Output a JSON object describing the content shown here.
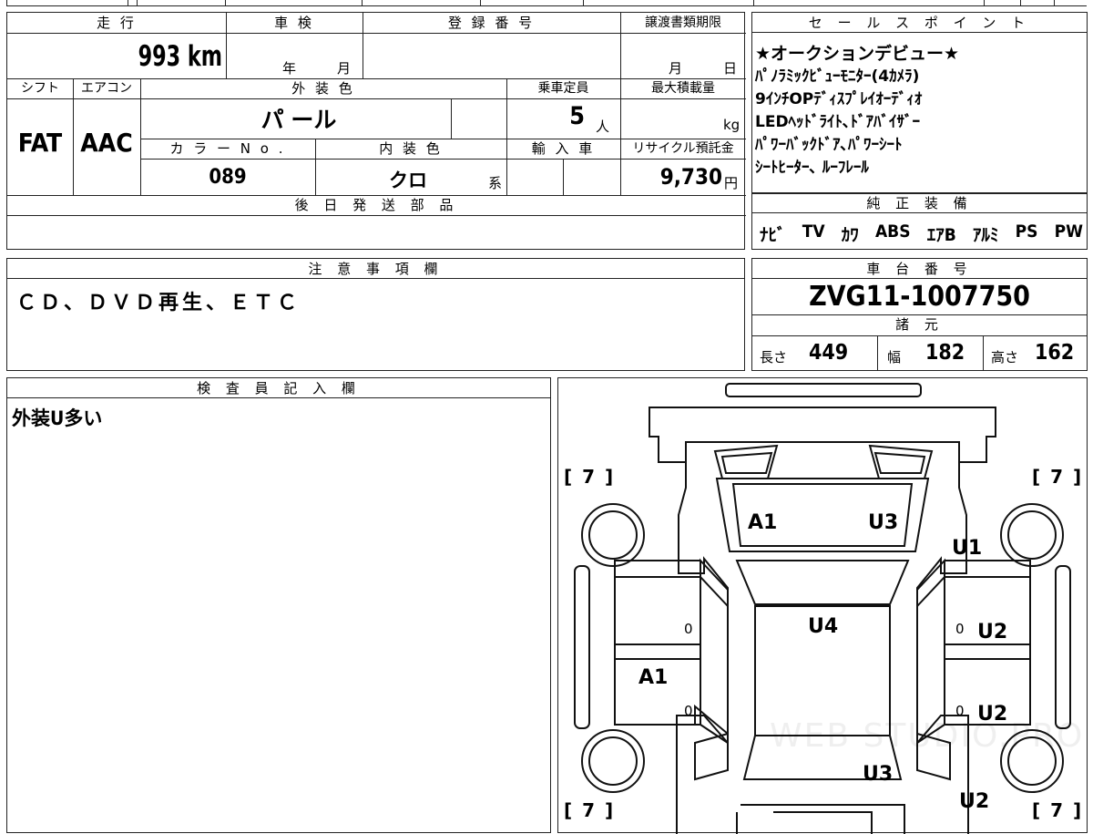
{
  "vehicle": {
    "headers": {
      "mileage": "走 行",
      "inspection": "車 検",
      "registration": "登 録 番 号",
      "transfer_deadline": "譲渡書類期限",
      "shift": "シフト",
      "aircon": "エアコン",
      "exterior_color": "外 装 色",
      "capacity": "乗車定員",
      "max_load": "最大積載量",
      "color_no": "カ ラ ー N o .",
      "interior_color": "内 装 色",
      "import": "輸 入 車",
      "recycle_fee": "リサイクル預託金",
      "later_parts": "後 日 発 送 部 品"
    },
    "mileage": "993",
    "mileage_unit": "km",
    "inspection_year_label": "年",
    "inspection_month_label": "月",
    "deadline_month_label": "月",
    "deadline_day_label": "日",
    "shift": "FAT",
    "aircon": "AAC",
    "exterior_color": "パ ール",
    "capacity": "5",
    "capacity_unit": "人",
    "max_load_unit": "kg",
    "color_no": "089",
    "interior_color": "クロ",
    "interior_suffix": "系",
    "recycle_fee": "9,730",
    "recycle_unit": "円"
  },
  "sales_points": {
    "header": "セ ー ル ス ポ イ ン ト",
    "lines": [
      "★オークションデビュー★",
      "ﾊﾟﾉﾗﾐｯｸﾋﾞｭｰﾓﾆﾀｰ(4ｶﾒﾗ)",
      "9ｲﾝﾁOPﾃﾞｨｽﾌﾟﾚｲｵｰﾃﾞｨｵ",
      "LEDﾍｯﾄﾞﾗｲﾄ､ﾄﾞｱﾊﾞｲｻﾞｰ",
      "ﾊﾟﾜｰﾊﾞｯｸﾄﾞｱ､ﾊﾟﾜｰｼｰﾄ",
      "ｼｰﾄﾋｰﾀｰ､ ﾙｰﾌﾚｰﾙ"
    ]
  },
  "genuine_equipment": {
    "header": "純 正 装 備",
    "items": [
      "ﾅﾋﾞ",
      "TV",
      "ｶﾜ",
      "ABS",
      "ｴｱB",
      "ｱﾙﾐ",
      "PS",
      "PW"
    ]
  },
  "notes": {
    "header": "注 意 事 項 欄",
    "text": "ＣＤ、ＤＶＤ再生、ＥＴＣ"
  },
  "chassis": {
    "header": "車 台 番 号",
    "number": "ZVG11-1007750",
    "specs_header": "諸 元",
    "length_label": "長さ",
    "length": "449",
    "width_label": "幅",
    "width": "182",
    "height_label": "高さ",
    "height": "162"
  },
  "inspector": {
    "header": "検 査 員 記 入 欄",
    "text": "外装U多い"
  },
  "diagram": {
    "tire_marks": [
      "[ 7 ]",
      "[ 7 ]",
      "[ 7 ]",
      "[ 7 ]"
    ],
    "damage_marks": [
      "A1",
      "U3",
      "U1",
      "U4",
      "U2",
      "A1",
      "U2",
      "U3",
      "U2"
    ],
    "zero_marks": [
      "0",
      "0",
      "0",
      "0"
    ],
    "watermark": "WEB STUDIO.PRO"
  }
}
